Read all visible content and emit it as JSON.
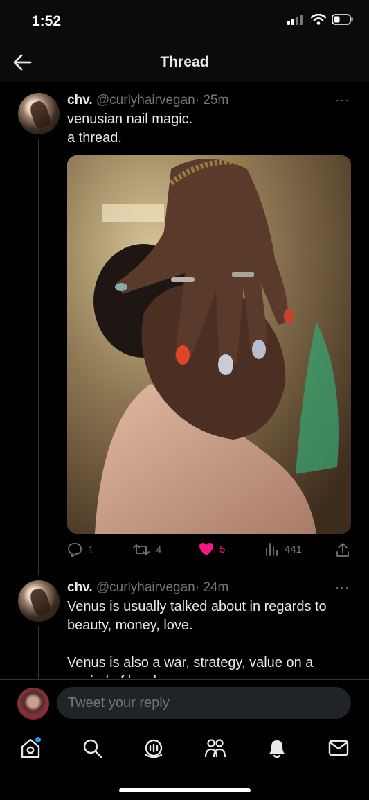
{
  "status_bar": {
    "time": "1:52",
    "icons": [
      "cellular-signal-icon",
      "wifi-icon",
      "battery-icon"
    ]
  },
  "header": {
    "title": "Thread",
    "back_icon": "arrow-left-icon"
  },
  "tweets": [
    {
      "name": "chv.",
      "handle": "@curlyhairvegan",
      "time": "· 25m",
      "lines": [
        "venusian nail magic.",
        "a thread."
      ],
      "media": "photo of a person covering face with hand showing painted nails and rings",
      "stats": {
        "replies": "1",
        "retweets": "4",
        "likes": "5",
        "views": "441"
      }
    },
    {
      "name": "chv.",
      "handle": "@curlyhairvegan",
      "time": "· 24m",
      "lines": [
        "Venus is usually talked about in regards to",
        "beauty, money, love.",
        "",
        "Venus is also a war, strategy, value on a",
        "myriad of levels"
      ]
    }
  ],
  "more_label": "···",
  "compose": {
    "placeholder": "Tweet your reply"
  },
  "tabbar": {
    "items": [
      "home-icon",
      "search-icon",
      "spaces-icon",
      "communities-icon",
      "notifications-icon",
      "messages-icon"
    ]
  },
  "colors": {
    "background": "#000000",
    "text": "#e7e9ea",
    "muted": "#71767b",
    "like": "#f91880",
    "notification_dot": "#1d9bf0"
  }
}
